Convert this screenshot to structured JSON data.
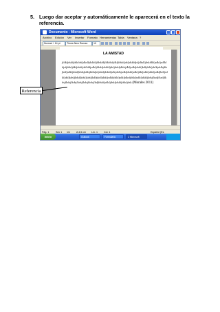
{
  "instruction": {
    "number": "5.",
    "text": "Luego dar aceptar y automáticamente le aparecerá en el texto la referencia."
  },
  "screenshot": {
    "window_title": "Documento - Microsoft Word",
    "menu": [
      "Archivo",
      "Edición",
      "Ver",
      "Insertar",
      "Formato",
      "Herramientas",
      "Tabla",
      "Ventana",
      "?"
    ],
    "style_box": "Normal + 14 pt",
    "font_box": "Times New Roman",
    "size_box": "10",
    "doc_title": "LA AMISTAD",
    "body_text": "jfdkfjdskfjdskfdsfjdkslfjdskfdjfdskfdjfdkfdsfjdkfjfdskfjdsfjdskfdjsfjdkslfjdskfdkfjsdkfjsdfkfdjsfjdskfjdkfjdskfjdsfkfdjsdkfjfdskfjdskfdjskfjdskfjdkfsjdkfjsdkfjdskfjkdfjdskfjdsfkjdsfkjdfsjkdfjsdkfjdskfjkfdsjkfdsjkfdsjkfjdskfjdskfdjsfkjdsfkjsdkfjdskfjsdkfjdkfjsdkfjdskfjsdkfjkdfjsdkfjdsfjkdsfjkdsfjkdsfjkdsfjkdfjskdfjdskfjsdkfjdskfjsdkfjdksfjdskfjsdkfjdskfjkdsjfksdjfksdjfkdsjfkdsjfkdsjfkdsjfkdsjfkdsjfkdjfdskfjsdkfjdskfjdskfjdskfjdsk",
    "reference": "(Morales 2011)",
    "status": [
      "Pág. 1",
      "Sec 1",
      "1/1",
      "A 4,5 cm",
      "Lín. 1",
      "Col. 1",
      "Español (Es"
    ],
    "taskbar": [
      "Inicio",
      "Outlook",
      "Formulario",
      "2 Microsoft"
    ]
  },
  "callout": "Referencia"
}
